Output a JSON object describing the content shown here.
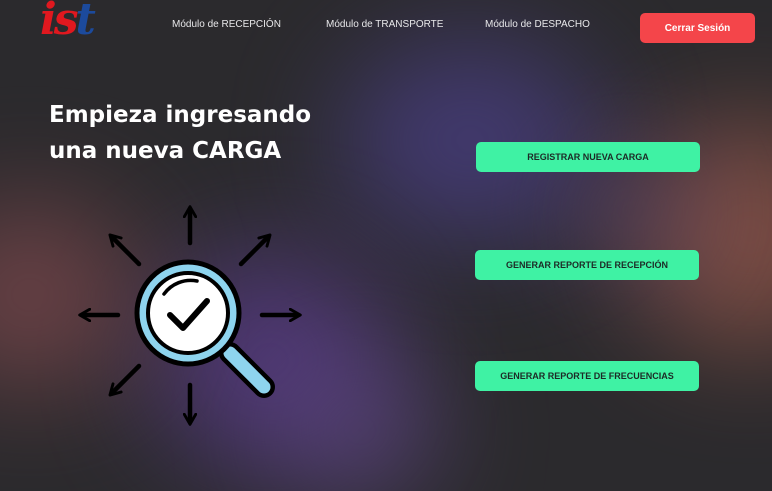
{
  "brand": {
    "logo_text_part1": "is",
    "logo_text_part2": "t",
    "colors": {
      "red": "#e0181f",
      "blue": "#1c4a9c"
    }
  },
  "nav": {
    "items": [
      {
        "label": "Módulo de RECEPCIÓN"
      },
      {
        "label": "Módulo de TRANSPORTE"
      },
      {
        "label": "Módulo de DESPACHO"
      }
    ],
    "logout_label": "Cerrar Sesión"
  },
  "hero": {
    "line1": "Empieza ingresando",
    "line2": "una nueva CARGA",
    "illustration_icon": "magnifier-checkmark-arrows-icon"
  },
  "actions": [
    {
      "label": "REGISTRAR NUEVA CARGA"
    },
    {
      "label": "GENERAR REPORTE DE RECEPCIÓN"
    },
    {
      "label": "GENERAR REPORTE DE FRECUENCIAS"
    }
  ],
  "colors": {
    "background": "#2b2a2d",
    "logout_button": "#f4454a",
    "action_button": "#3ff2a4",
    "magnifier_lens": "#8ed4ee"
  }
}
